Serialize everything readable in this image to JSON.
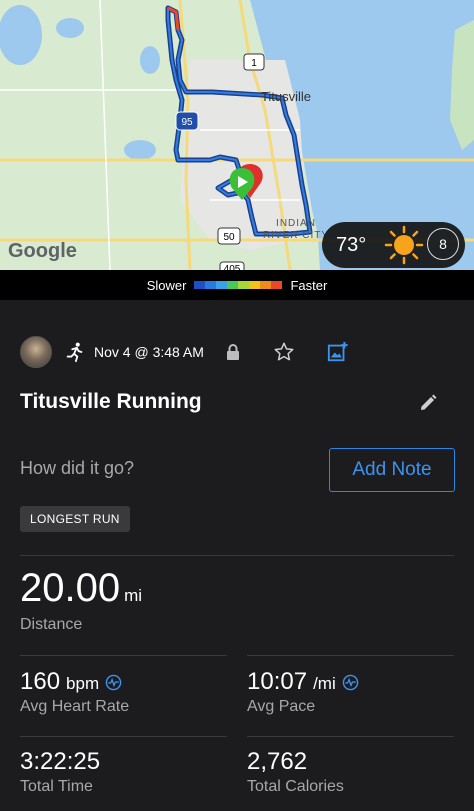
{
  "map": {
    "google_logo": "Google",
    "labels": {
      "city": "Titusville",
      "route_1": "1",
      "route_95": "95",
      "route_50": "50",
      "route_405": "405",
      "indian": "INDIAN",
      "river_city": "RIVER CITY"
    },
    "weather": {
      "temperature": "73°",
      "wind": "8",
      "condition_icon": "sun-icon"
    }
  },
  "pace_legend": {
    "slower": "Slower",
    "faster": "Faster",
    "colors": [
      "#1e50c8",
      "#2a78e0",
      "#3aa0e8",
      "#4cc85a",
      "#a8d838",
      "#f2c418",
      "#f08a1c",
      "#e84a28"
    ]
  },
  "activity": {
    "date": "Nov 4 @ 3:48 AM",
    "type_icon": "running-icon",
    "title": "Titusville Running",
    "prompt": "How did it go?",
    "add_note_label": "Add Note",
    "badge": "LONGEST RUN"
  },
  "stats": {
    "distance": {
      "value": "20.00",
      "unit": "mi",
      "label": "Distance"
    },
    "heart_rate": {
      "value": "160",
      "unit": "bpm",
      "label": "Avg Heart Rate"
    },
    "pace": {
      "value": "10:07",
      "unit": "/mi",
      "label": "Avg Pace"
    },
    "time": {
      "value": "3:22:25",
      "label": "Total Time"
    },
    "calories": {
      "value": "2,762",
      "label": "Total Calories"
    }
  }
}
